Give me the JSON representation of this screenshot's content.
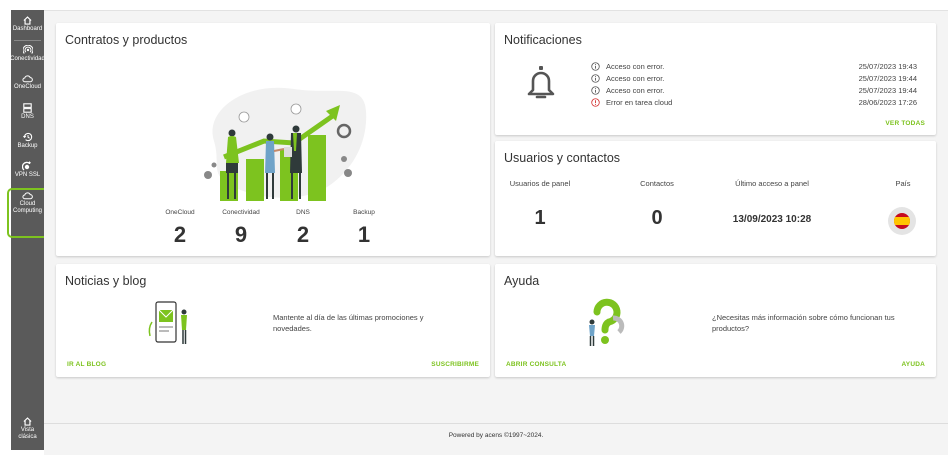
{
  "sidebar": {
    "items": [
      {
        "label": "Dashboard",
        "icon": "home-icon"
      },
      {
        "label": "Conectividad",
        "icon": "antenna-icon"
      },
      {
        "label": "OneCloud",
        "icon": "cloud-icon"
      },
      {
        "label": "DNS",
        "icon": "server-icon"
      },
      {
        "label": "Backup",
        "icon": "history-icon"
      },
      {
        "label": "VPN SSL",
        "icon": "vpn-icon"
      },
      {
        "label": "Cloud Computing",
        "icon": "cloud-icon"
      }
    ],
    "bottom": {
      "label": "Vista clásica",
      "icon": "home-icon"
    },
    "active_color": "#7dc31f"
  },
  "contracts": {
    "title": "Contratos y productos",
    "stats": [
      {
        "label": "OneCloud",
        "value": "2"
      },
      {
        "label": "Conectividad",
        "value": "9"
      },
      {
        "label": "DNS",
        "value": "2"
      },
      {
        "label": "Backup",
        "value": "1"
      }
    ]
  },
  "notifications": {
    "title": "Notificaciones",
    "items": [
      {
        "text": "Acceso con error.",
        "date": "25/07/2023 19:43",
        "status": "info"
      },
      {
        "text": "Acceso con error.",
        "date": "25/07/2023 19:44",
        "status": "info"
      },
      {
        "text": "Acceso con error.",
        "date": "25/07/2023 19:44",
        "status": "info"
      },
      {
        "text": "Error en tarea cloud",
        "date": "28/06/2023 17:26",
        "status": "error"
      }
    ],
    "link": "VER TODAS"
  },
  "users": {
    "title": "Usuarios y contactos",
    "headers": {
      "panel_users": "Usuarios de panel",
      "contacts": "Contactos",
      "last_access": "Último acceso a panel",
      "country": "País"
    },
    "values": {
      "panel_users": "1",
      "contacts": "0",
      "last_access": "13/09/2023 10:28"
    }
  },
  "news": {
    "title": "Noticias y blog",
    "text": "Mantente al día de las últimas promociones y novedades.",
    "link_blog": "IR AL BLOG",
    "link_subscribe": "SUSCRIBIRME"
  },
  "help": {
    "title": "Ayuda",
    "text": "¿Necesitas más información sobre cómo funcionan tus productos?",
    "link_ticket": "ABRIR CONSULTA",
    "link_help": "AYUDA"
  },
  "footer": {
    "text": "Powered by acens ©1997~2024."
  },
  "colors": {
    "accent": "#7dc31f",
    "sidebar": "#5a5a5a",
    "error": "#d32f2f"
  }
}
